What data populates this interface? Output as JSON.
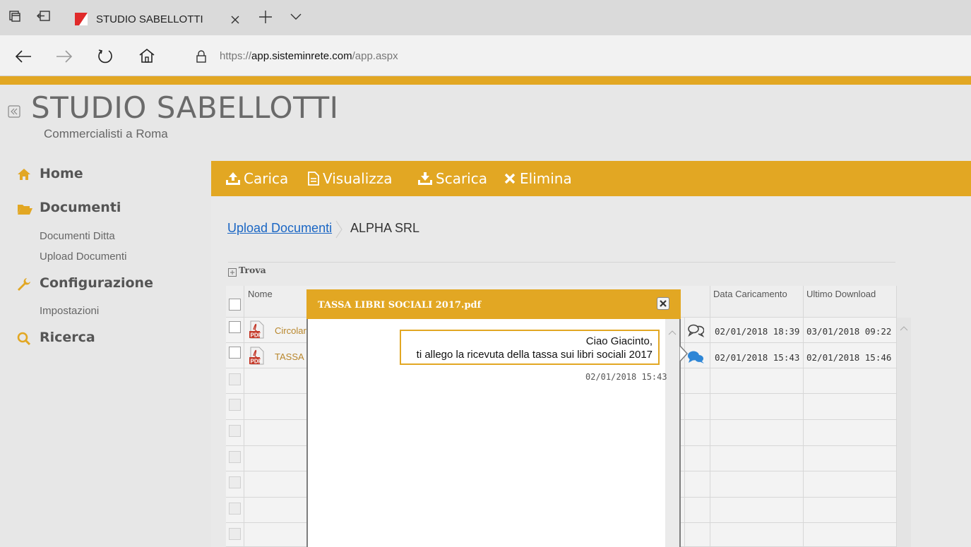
{
  "browser": {
    "tab_title": "STUDIO SABELLOTTI",
    "url_prefix": "https://",
    "url_host": "app.sisteminrete.com",
    "url_path": "/app.aspx",
    "icons": [
      "tabs-icon",
      "back-tab-icon",
      "favicon",
      "close-icon",
      "new-tab-icon",
      "chevron-down-icon",
      "back-arrow-icon",
      "forward-arrow-icon",
      "refresh-icon",
      "home-icon",
      "lock-icon"
    ]
  },
  "brand": {
    "title": "STUDIO SABELLOTTI",
    "subtitle": "Commercialisti a Roma"
  },
  "sidebar": {
    "home": "Home",
    "documenti": "Documenti",
    "documenti_ditta": "Documenti Ditta",
    "upload_documenti": "Upload Documenti",
    "configurazione": "Configurazione",
    "impostazioni": "Impostazioni",
    "ricerca": "Ricerca"
  },
  "toolbar": {
    "carica": "Carica",
    "visualizza": "Visualizza",
    "scarica": "Scarica",
    "elimina": "Elimina"
  },
  "breadcrumb": {
    "link": "Upload Documenti",
    "current": "ALPHA SRL"
  },
  "trova": "Trova",
  "grid": {
    "col_nome": "Nome",
    "col_data_caricamento": "Data Caricamento",
    "col_ultimo_download": "Ultimo Download",
    "rows": [
      {
        "nome": "Circolar",
        "data": "02/01/2018 18:39",
        "download": "03/01/2018 09:22"
      },
      {
        "nome": "TASSA",
        "data": "02/01/2018 15:43",
        "download": "02/01/2018 15:46"
      }
    ]
  },
  "modal": {
    "title": "TASSA LIBRI SOCIALI 2017.pdf",
    "message_line1": "Ciao Giacinto,",
    "message_line2": "ti allego la ricevuta della tassa sui libri sociali 2017",
    "message_time": "02/01/2018 15:43"
  },
  "colors": {
    "accent": "#e2a723",
    "link": "#1a66c4",
    "chat_blue": "#2e86d6"
  }
}
